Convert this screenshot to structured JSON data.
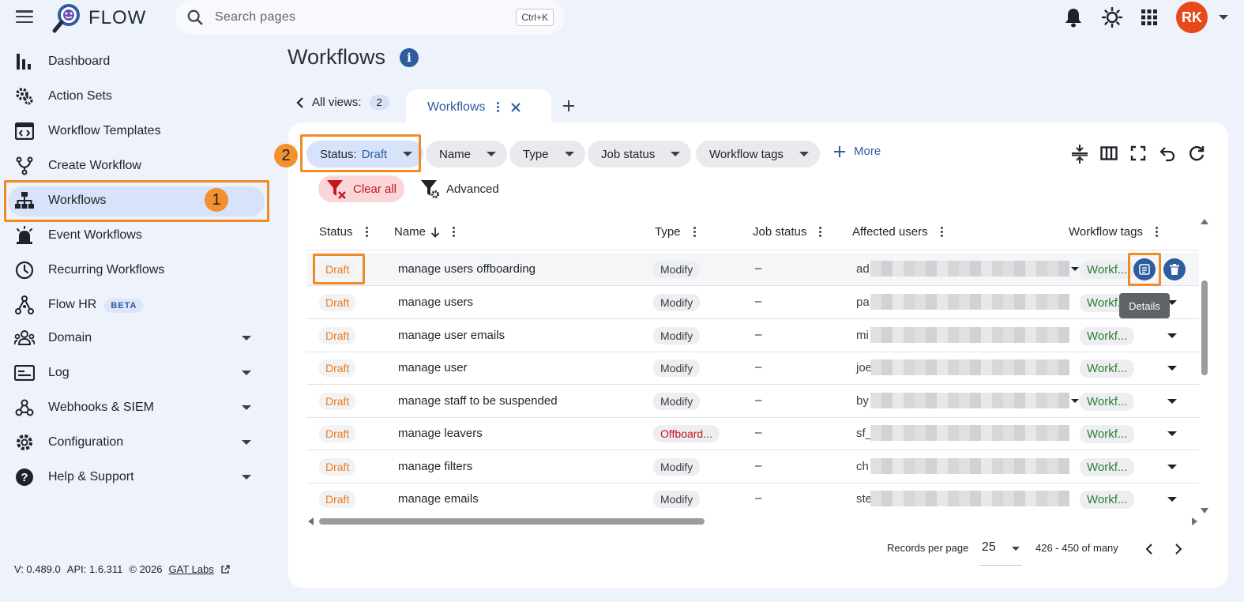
{
  "header": {
    "app_name": "FLOW",
    "search_placeholder": "Search pages",
    "search_shortcut": "Ctrl+K",
    "avatar_initials": "RK"
  },
  "sidebar": {
    "items": [
      {
        "label": "Dashboard",
        "icon": "bar-chart-icon"
      },
      {
        "label": "Action Sets",
        "icon": "gears-icon"
      },
      {
        "label": "Workflow Templates",
        "icon": "template-icon"
      },
      {
        "label": "Create Workflow",
        "icon": "branch-icon"
      },
      {
        "label": "Workflows",
        "icon": "hierarchy-icon",
        "active": true
      },
      {
        "label": "Event Workflows",
        "icon": "alarm-icon"
      },
      {
        "label": "Recurring Workflows",
        "icon": "clock-icon"
      },
      {
        "label": "Flow HR",
        "icon": "tree-icon",
        "badge": "BETA"
      },
      {
        "label": "Domain",
        "icon": "people-icon",
        "expandable": true
      },
      {
        "label": "Log",
        "icon": "log-icon",
        "expandable": true
      },
      {
        "label": "Webhooks & SIEM",
        "icon": "webhook-icon",
        "expandable": true
      },
      {
        "label": "Configuration",
        "icon": "gear-icon",
        "expandable": true
      },
      {
        "label": "Help & Support",
        "icon": "help-icon",
        "expandable": true
      }
    ],
    "footer": {
      "version": "V: 0.489.0",
      "api": "API: 1.6.311",
      "copyright": "© 2026",
      "link": "GAT Labs"
    }
  },
  "annotations": {
    "step1": "1",
    "step2": "2"
  },
  "main": {
    "title": "Workflows",
    "views_label": "All views:",
    "views_count": "2",
    "active_tab": "Workflows",
    "filters": {
      "status_label": "Status:",
      "status_value": "Draft",
      "chips": [
        "Name",
        "Type",
        "Job status",
        "Workflow tags"
      ],
      "more_label": "More",
      "clear_all": "Clear all",
      "advanced": "Advanced"
    },
    "columns": [
      "Status",
      "Name",
      "Type",
      "Job status",
      "Affected users",
      "Workflow tags"
    ],
    "rows": [
      {
        "status": "Draft",
        "name": "manage users offboarding",
        "type": "Modify",
        "job": "–",
        "users": "ad",
        "tag": "Workf..."
      },
      {
        "status": "Draft",
        "name": "manage users",
        "type": "Modify",
        "job": "–",
        "users": "pa",
        "tag": "Workf..."
      },
      {
        "status": "Draft",
        "name": "manage user emails",
        "type": "Modify",
        "job": "–",
        "users": "mi",
        "tag": "Workf..."
      },
      {
        "status": "Draft",
        "name": "manage user",
        "type": "Modify",
        "job": "–",
        "users": "joe",
        "tag": "Workf..."
      },
      {
        "status": "Draft",
        "name": "manage staff to be suspended",
        "type": "Modify",
        "job": "–",
        "users": "by",
        "tag": "Workf..."
      },
      {
        "status": "Draft",
        "name": "manage leavers",
        "type": "Offboard...",
        "job": "–",
        "users": "sf_",
        "tag": "Workf..."
      },
      {
        "status": "Draft",
        "name": "manage filters",
        "type": "Modify",
        "job": "–",
        "users": "ch",
        "tag": "Workf..."
      },
      {
        "status": "Draft",
        "name": "manage emails",
        "type": "Modify",
        "job": "–",
        "users": "ste",
        "tag": "Workf..."
      }
    ],
    "tooltip": "Details",
    "pagination": {
      "records_label": "Records per page",
      "per_page": "25",
      "range": "426 - 450 of many"
    }
  },
  "colors": {
    "accent": "#2d5d9f",
    "highlight": "#f08a24",
    "draft": "#f07a1a",
    "danger": "#c4161c",
    "tag": "#2e7d32"
  }
}
